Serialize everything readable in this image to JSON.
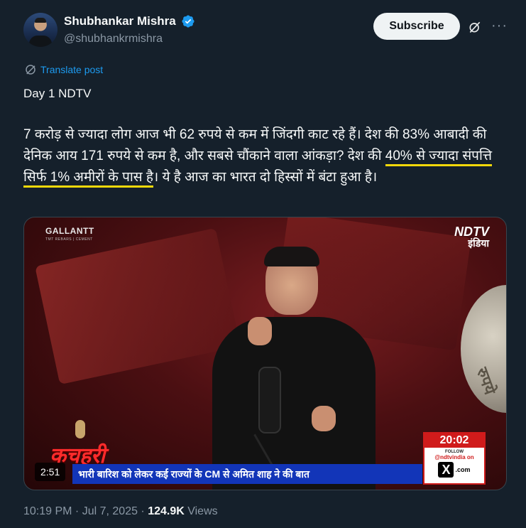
{
  "author": {
    "display_name": "Shubhankar Mishra",
    "handle": "@shubhankrmishra",
    "verified_icon": "verified-badge-icon"
  },
  "actions": {
    "subscribe_label": "Subscribe",
    "grok_icon": "grok-icon",
    "more_icon": "more-options-icon"
  },
  "translate": {
    "label": "Translate post"
  },
  "post": {
    "title": "Day 1 NDTV",
    "text_before": "7 करोड़ से ज्यादा लोग आज भी 62 रुपये से कम में जिंदगी काट रहे हैं। देश की 83% आबादी की देनिक आय 171 रुपये से कम है, और सबसे चौंकाने वाला आंकड़ा? देश की ",
    "text_highlight": "40% से ज्यादा संपत्ति सिर्फ 1% अमीरों के पास है",
    "text_after": "। ये है आज का भारत दो हिस्सों में बंटा हुआ है।"
  },
  "video": {
    "duration": "2:51",
    "sponsor_name": "GALLANTT",
    "sponsor_tagline": "TMT REBARS | CEMENT",
    "channel_name": "NDTV",
    "channel_sub": "इंडिया",
    "show_name": "कचहरी",
    "ticker_text": "भारी बारिश को लेकर कई राज्यों के CM से अमित शाह ने की बात",
    "clock_time": "20:02",
    "follow_label": "FOLLOW",
    "follow_handle": "@ndtvindia on",
    "x_label": "X",
    "x_suffix": ".com",
    "coin_text": "रुपये"
  },
  "meta": {
    "time": "10:19 PM",
    "separator": " · ",
    "date": "Jul 7, 2025",
    "views_count": "124.9K",
    "views_label": " Views"
  },
  "colors": {
    "background": "#15202b",
    "accent": "#1d9bf0",
    "highlight_underline": "#f5d90a",
    "muted": "#8b98a5"
  }
}
